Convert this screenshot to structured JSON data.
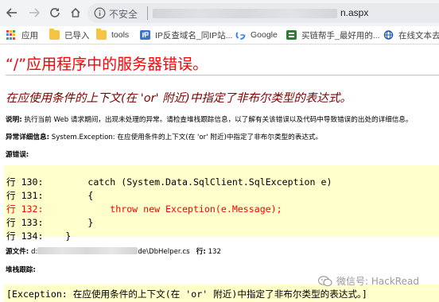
{
  "browser": {
    "security_label": "不安全",
    "url_suffix": "n.aspx",
    "bookmarks": [
      {
        "label": "应用",
        "icon": "apps-icon"
      },
      {
        "label": "已导入",
        "icon": "folder-icon"
      },
      {
        "label": "tools",
        "icon": "folder-icon"
      },
      {
        "label": "IP反查域名_同IP站...",
        "icon": "ip-site-icon"
      },
      {
        "label": "Google",
        "icon": "google-icon"
      },
      {
        "label": "买链帮手_最好用的...",
        "icon": "link-site-icon"
      },
      {
        "label": "在线文本去重",
        "icon": "globe-icon"
      }
    ]
  },
  "error_page": {
    "title": "“/”应用程序中的服务器错误。",
    "message": "在应使用条件的上下文(在 'or' 附近)中指定了非布尔类型的表达式。",
    "description_label": "说明:",
    "description_text": "执行当前 Web 请求期间，出现未处理的异常。请检查堆栈跟踪信息，以了解有关该错误以及代码中导致错误的出处的详细信息。",
    "exception_label": "异常详细信息:",
    "exception_text": "System.Exception: 在应使用条件的上下文(在 'or' 附近)中指定了非布尔类型的表达式。",
    "source_error_label": "源错误:",
    "code_lines": [
      {
        "text": "行 130:        catch (System.Data.SqlClient.SqlException e)",
        "highlight": false
      },
      {
        "text": "行 131:        {",
        "highlight": false
      },
      {
        "text": "行 132:            throw new Exception(e.Message);",
        "highlight": true
      },
      {
        "text": "行 133:        }",
        "highlight": false
      },
      {
        "text": "行 134:    }",
        "highlight": false
      }
    ],
    "source_file_label": "源文件:",
    "source_file_prefix": "d:",
    "source_file_suffix": "de\\DbHelper.cs",
    "line_label": "行:",
    "line_number": "132",
    "stack_trace_label": "堆栈跟踪:",
    "stack_trace_text": "[Exception: 在应使用条件的上下文(在 'or' 附近)中指定了非布尔类型的表达式。]"
  },
  "watermark": {
    "text": "微信号: HackRead"
  },
  "colors": {
    "title": "#ff0000",
    "message": "#800000",
    "code_bg": "#ffffcc",
    "highlight": "#ff0000"
  }
}
